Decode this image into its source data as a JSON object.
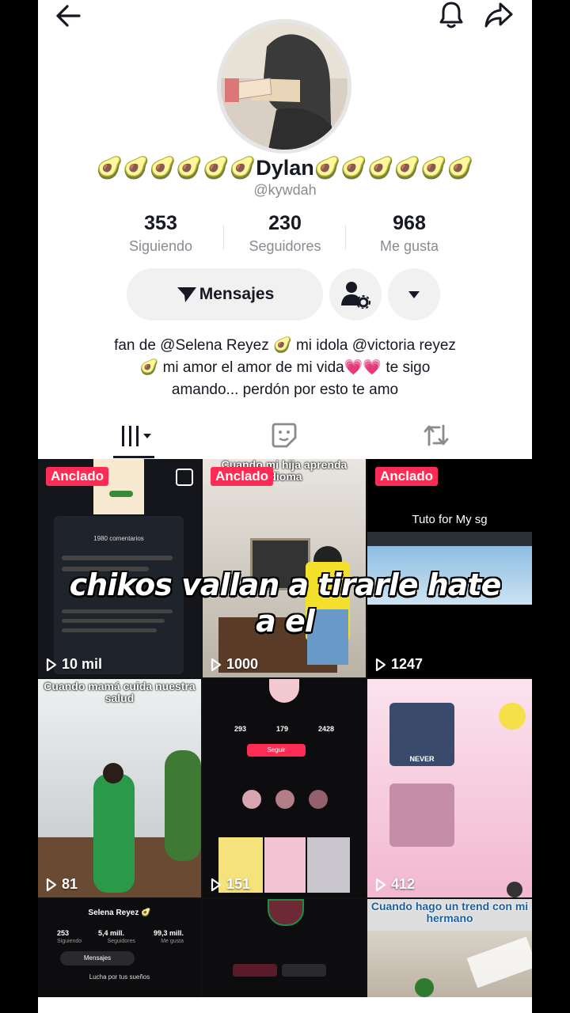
{
  "header": {
    "back_icon": "arrow-left-icon",
    "bell_icon": "bell-icon",
    "share_icon": "share-icon"
  },
  "profile": {
    "display_name": "🥑🥑🥑🥑🥑🥑Dylan🥑🥑🥑🥑🥑🥑",
    "username": "@kywdah",
    "stats": [
      {
        "value": "353",
        "label": "Siguiendo"
      },
      {
        "value": "230",
        "label": "Seguidores"
      },
      {
        "value": "968",
        "label": "Me gusta"
      }
    ],
    "message_button": "Mensajes",
    "bio_lines": [
      "fan de @Selena Reyez 🥑 mi idola @victoria reyez",
      "🥑 mi amor el amor de mi vida💗💗 te sigo",
      "amando... perdón por esto te amo"
    ]
  },
  "tabs": [
    "videos-tab",
    "favorites-tab",
    "reposts-tab"
  ],
  "overlay": {
    "line1": "chikos vallan a tirarle hate",
    "line2": "a el"
  },
  "videos": [
    {
      "views": "10 mil",
      "pinned": "Anclado",
      "caption": ""
    },
    {
      "views": "1000",
      "pinned": "Anclado",
      "caption": "Cuando mi hija aprenda idioma"
    },
    {
      "views": "1247",
      "pinned": "Anclado",
      "caption": "Tuto for My sg"
    },
    {
      "views": "81",
      "pinned": "",
      "caption": "Cuando mamá cuida nuestra salud"
    },
    {
      "views": "151",
      "pinned": "",
      "caption": ""
    },
    {
      "views": "412",
      "pinned": "",
      "caption": ""
    },
    {
      "views": "",
      "pinned": "",
      "caption": "Selena Reyez 🥑"
    },
    {
      "views": "",
      "pinned": "",
      "caption": ""
    },
    {
      "views": "",
      "pinned": "",
      "caption": "Cuando hago un trend con mi hermano"
    }
  ],
  "thumb_texts": {
    "comments": "1980 comentarios",
    "selena_stats": [
      "253",
      "5,4 mill.",
      "99,3 mill."
    ],
    "selena_labels": [
      "Siguiendo",
      "Seguidores",
      "Me gusta"
    ],
    "selena_msg": "Mensajes",
    "selena_bio": "Lucha por tus sueños",
    "profile2_stats": [
      "293",
      "179",
      "2428"
    ],
    "profile2_btn": "Seguir",
    "never": "NEVER"
  },
  "colors": {
    "accent": "#fe2c55",
    "text": "#161823",
    "muted": "#8a8b91",
    "button_bg": "#f1f1f2"
  }
}
